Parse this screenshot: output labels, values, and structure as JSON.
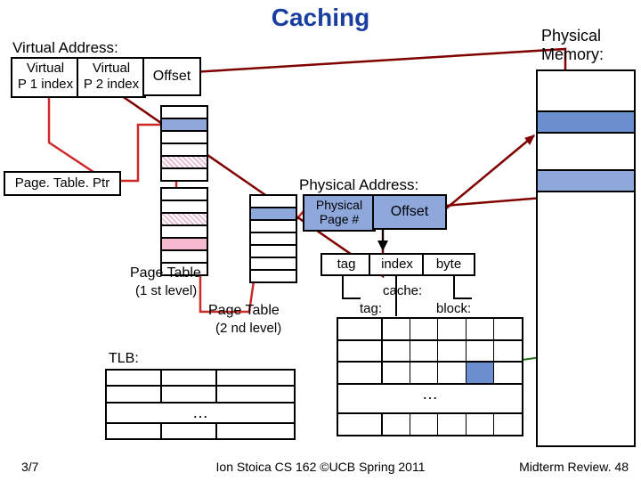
{
  "title": "Caching",
  "virtual_address": {
    "heading": "Virtual Address:",
    "p1": "Virtual\nP 1 index",
    "p2": "Virtual\nP 2 index",
    "offset": "Offset"
  },
  "page_table_ptr": "Page. Table. Ptr",
  "page_table_1": "Page Table",
  "page_table_1_sub": "(1 st level)",
  "page_table_2": "Page Table",
  "page_table_2_sub": "(2 nd level)",
  "tlb_label": "TLB:",
  "physical_memory_label": "Physical\nMemory:",
  "physical_address": {
    "heading": "Physical Address:",
    "page": "Physical\nPage #",
    "offset": "Offset"
  },
  "cache_breakdown": {
    "tag": "tag",
    "index": "index",
    "byte": "byte"
  },
  "cache_labels": {
    "cache": "cache:",
    "tag": "tag:",
    "block": "block:"
  },
  "ellipsis": "…",
  "footer": {
    "left": "3/7",
    "center": "Ion Stoica CS 162 ©UCB Spring 2011",
    "right": "Midterm Review. 48"
  }
}
